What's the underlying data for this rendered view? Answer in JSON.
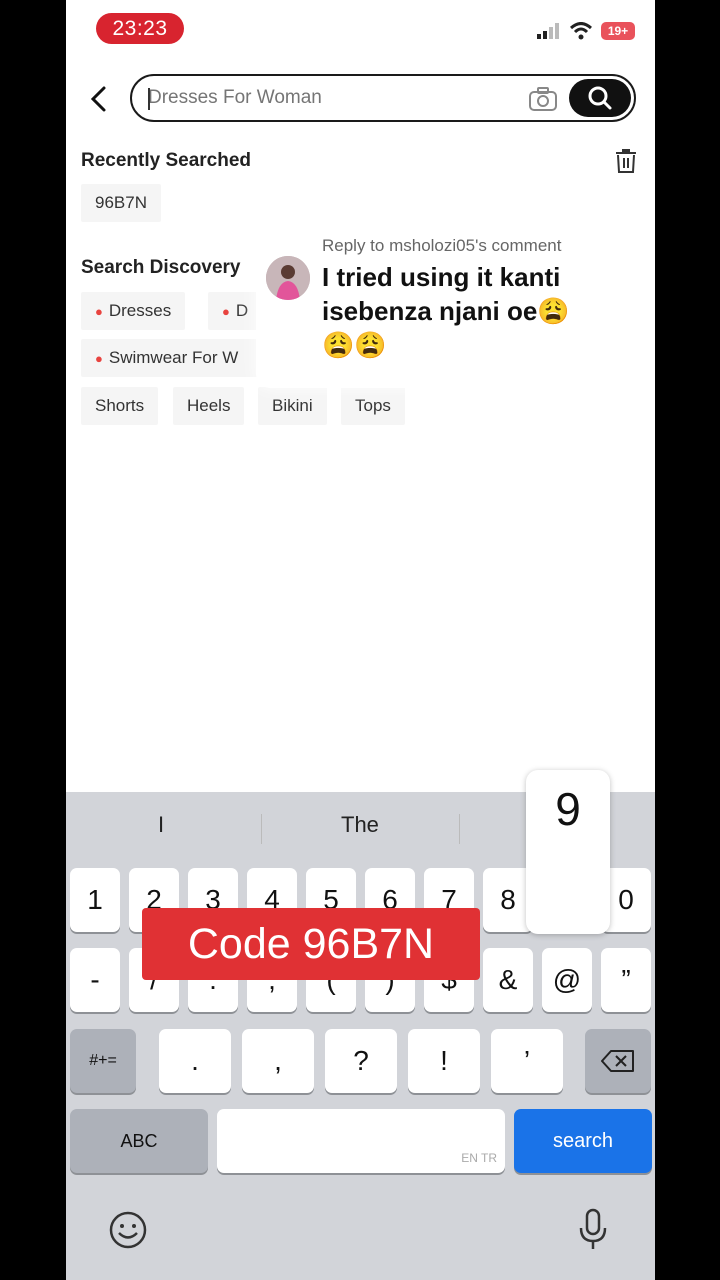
{
  "status_bar": {
    "time": "23:23",
    "battery": "19+"
  },
  "search": {
    "placeholder": "Dresses For Woman"
  },
  "recent": {
    "title": "Recently Searched",
    "items": [
      "96B7N"
    ]
  },
  "discovery": {
    "title": "Search Discovery",
    "chips": [
      "Dresses",
      "D",
      "Swimwear For W"
    ],
    "plain_chips": [
      "Shorts",
      "Heels",
      "Bikini",
      "Tops"
    ]
  },
  "comment": {
    "reply_label": "Reply to msholozi05's comment",
    "text": "I tried using it kanti isebenza njani oe😩😩😩"
  },
  "keyboard": {
    "suggestions": [
      "I",
      "The"
    ],
    "row1": [
      "1",
      "2",
      "3",
      "4",
      "5",
      "6",
      "7",
      "8",
      "9",
      "0"
    ],
    "row2": [
      "-",
      "/",
      ":",
      ";",
      "(",
      ")",
      "$",
      "&",
      "@",
      "”"
    ],
    "row3": [
      ".",
      ",",
      "?",
      "!",
      "’"
    ],
    "mode_key": "#+=",
    "abc_key": "ABC",
    "search_key": "search",
    "space_hint": "EN TR",
    "popup_key": "9"
  },
  "overlay": {
    "code_text": "Code 96B7N"
  },
  "colors": {
    "accent_red": "#e03134",
    "search_blue": "#1a73e8"
  }
}
